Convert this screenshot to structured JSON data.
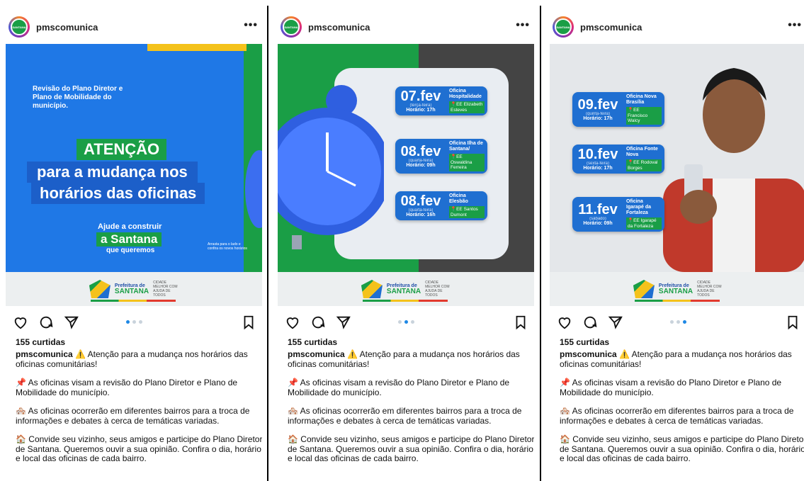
{
  "username": "pmscomunica",
  "avatar_text": "SANTANA",
  "more_label": "•••",
  "likes": "155 curtidas",
  "caption": {
    "user": "pmscomunica",
    "line1": "⚠️ Atenção para a mudança nos horários das oficinas comunitárias!",
    "p2": "📌 As oficinas visam a revisão do Plano Diretor e Plano de Mobilidade do município.",
    "p3": "🏘️ As oficinas ocorrerão em diferentes bairros para a troca de informações e debates à cerca de temáticas variadas.",
    "p4": "🏠 Convide seu vizinho, seus amigos e participe do Plano Diretor de Santana. Queremos ouvir a sua opinião. Confira o dia, horário e local das oficinas de cada bairro."
  },
  "footer": {
    "prefeitura": "Prefeitura de",
    "santana": "SANTANA",
    "slogan": "CIDADE MELHOR COM AJUDA DE TODOS"
  },
  "icons": [
    "heart-icon",
    "comment-icon",
    "share-icon",
    "bookmark-icon",
    "more-icon"
  ],
  "colors": {
    "blue": "#1f6fd1",
    "green": "#1a9e46",
    "yellow": "#f4c21b"
  },
  "slide1": {
    "intro": "Revisão do Plano Diretor e Plano de Mobilidade do município.",
    "atencao": "ATENÇÃO",
    "headline1": "para a mudança nos",
    "headline2": "horários das oficinas",
    "ajude": "Ajude a construir",
    "santana": "a Santana",
    "queremos": "que queremos",
    "arraste": "Arrasta para o lado e confira os novos horários"
  },
  "slide2": [
    {
      "date": "07.fev",
      "weekday": "(terça-feira)",
      "time": "Horário: 17h",
      "oficina": "Oficina Hospitalidade",
      "local": "📍EE Elizabeth Esteves"
    },
    {
      "date": "08.fev",
      "weekday": "(quarta-feira)",
      "time": "Horário: 09h",
      "oficina": "Oficina Ilha de Santana/",
      "local": "📍EE Oswaldina Ferreira"
    },
    {
      "date": "08.fev",
      "weekday": "(quarta-feira)",
      "time": "Horário: 16h",
      "oficina": "Oficina Elesbão",
      "local": "📍EE Santos Dumont"
    }
  ],
  "slide3": [
    {
      "date": "09.fev",
      "weekday": "(quinta-feira)",
      "time": "Horário: 17h",
      "oficina": "Oficina Nova Brasília",
      "local": "📍EE Francisco Walcy"
    },
    {
      "date": "10.fev",
      "weekday": "(sexta-feira)",
      "time": "Horário: 17h",
      "oficina": "Oficina Fonte Nova",
      "local": "📍EE Rodoval Borges"
    },
    {
      "date": "11.fev",
      "weekday": "(sábado)",
      "time": "Horário: 09h",
      "oficina": "Oficina Igarapé da Fortaleza",
      "local": "📍EE Igarapé da Fortaleza"
    }
  ],
  "carousel": [
    1,
    2,
    3
  ]
}
